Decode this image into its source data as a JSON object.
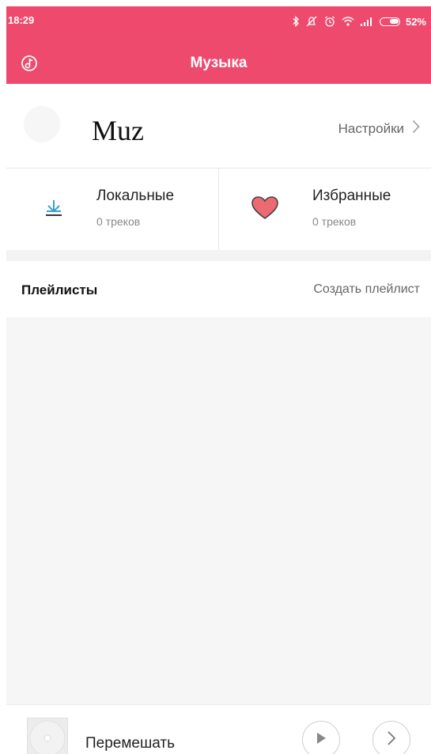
{
  "status_bar": {
    "time": "18:29",
    "battery": "52%",
    "icons": [
      "bluetooth-icon",
      "alarm-off-icon",
      "alarm-icon",
      "wifi-icon",
      "signal-icon",
      "battery-icon"
    ]
  },
  "header": {
    "title": "Музыка",
    "left_icon": "music-note-icon",
    "background": "#ee4a6e"
  },
  "profile": {
    "name": "Muz",
    "settings_label": "Настройки"
  },
  "tiles": [
    {
      "label": "Локальные",
      "count": "0 треков",
      "icon": "download-icon"
    },
    {
      "label": "Избранные",
      "count": "0 треков",
      "icon": "heart-icon"
    }
  ],
  "playlists": {
    "title": "Плейлисты",
    "create_label": "Создать плейлист"
  },
  "player": {
    "label": "Перемешать"
  },
  "colors": {
    "accent": "#ee4a6e",
    "heart": "#ee6a73",
    "download": "#3aa0cf"
  }
}
